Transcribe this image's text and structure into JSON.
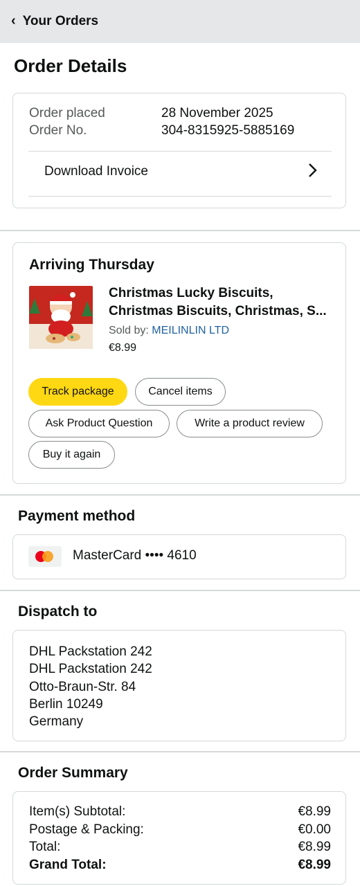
{
  "header": {
    "back_icon": "chevron-left-icon",
    "title": "Your Orders"
  },
  "page_title": "Order Details",
  "order_info": {
    "placed_label": "Order placed",
    "placed_value": "28 November 2025",
    "number_label": "Order No.",
    "number_value": "304-8315925-5885169",
    "invoice_label": "Download Invoice",
    "invoice_icon": "chevron-right-icon"
  },
  "shipment": {
    "status": "Arriving Thursday",
    "product_title_line1": "Christmas Lucky Biscuits,",
    "product_title_line2": "Christmas Biscuits, Christmas, S...",
    "sold_by_label": "Sold by:",
    "seller": "MEILINLIN LTD",
    "price": "€8.99",
    "buttons": {
      "track": "Track package",
      "cancel": "Cancel items",
      "ask": "Ask Product Question",
      "review": "Write a product review",
      "buy_again": "Buy it again"
    },
    "accent_color": "#ffd814",
    "seller_link_color": "#2162a1"
  },
  "payment": {
    "title": "Payment method",
    "card_icon": "mastercard-icon",
    "card_text": "MasterCard •••• 4610"
  },
  "dispatch": {
    "title": "Dispatch to",
    "lines": [
      "DHL Packstation 242",
      "DHL Packstation 242",
      "Otto-Braun-Str. 84",
      "Berlin 10249",
      "Germany"
    ]
  },
  "summary": {
    "title": "Order Summary",
    "rows": [
      {
        "label": "Item(s) Subtotal:",
        "value": "€8.99"
      },
      {
        "label": "Postage & Packing:",
        "value": "€0.00"
      },
      {
        "label": "Total:",
        "value": "€8.99"
      },
      {
        "label": "Grand Total:",
        "value": "€8.99"
      }
    ]
  }
}
